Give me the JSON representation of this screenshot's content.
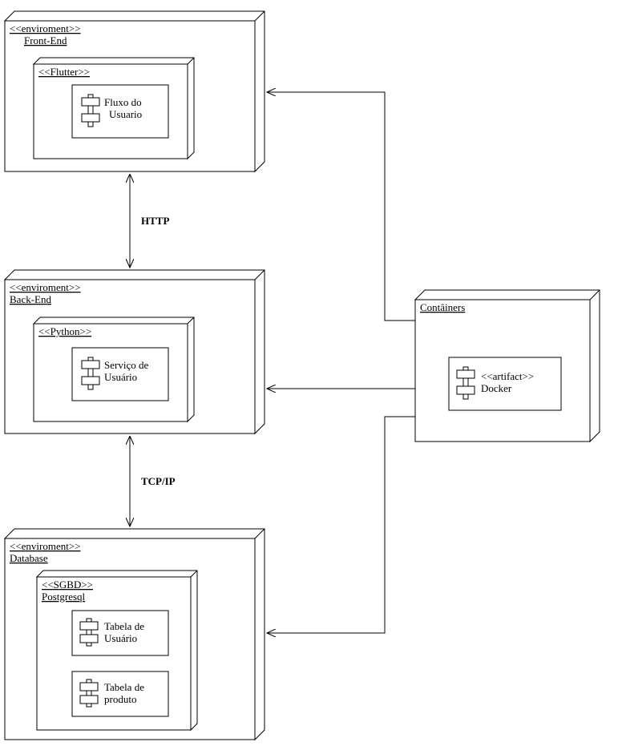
{
  "diagram": {
    "frontend": {
      "stereotype": "<<enviroment>>",
      "name": "Front-End",
      "inner": {
        "stereotype": "<<Flutter>>",
        "component1": {
          "line1": "Fluxo do",
          "line2": "Usuario"
        }
      }
    },
    "backend": {
      "stereotype": "<<enviroment>>",
      "name": "Back-End",
      "inner": {
        "stereotype": "<<Python>>",
        "component1": {
          "line1": "Serviço de",
          "line2": "Usuário"
        }
      }
    },
    "database": {
      "stereotype": "<<enviroment>>",
      "name": "Database",
      "inner": {
        "stereotype": "<<SGBD>>",
        "name": "Postgresql",
        "component1": {
          "line1": "Tabela de",
          "line2": "Usuário"
        },
        "component2": {
          "line1": "Tabela de",
          "line2": "produto"
        }
      }
    },
    "containers": {
      "name": "Contâiners",
      "component1": {
        "line1": "<<artifact>>",
        "line2": "Docker"
      }
    },
    "connections": {
      "http": "HTTP",
      "tcpip": "TCP/IP"
    }
  }
}
